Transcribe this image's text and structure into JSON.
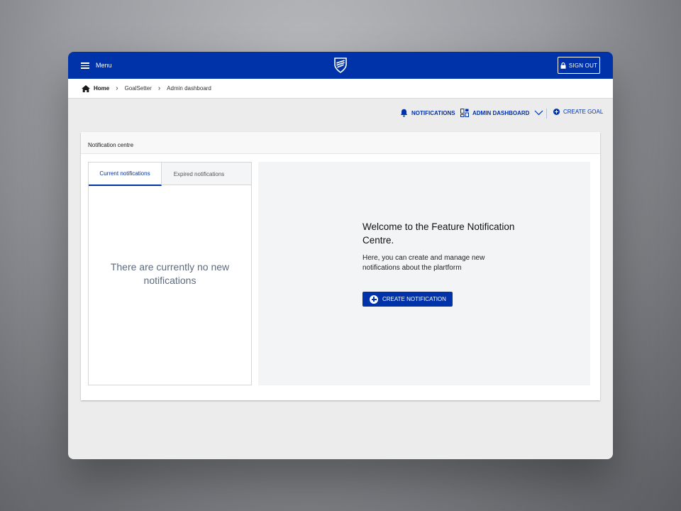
{
  "topbar": {
    "menu_label": "Menu",
    "signout_label": "SIGN OUT"
  },
  "breadcrumb": {
    "home": "Home",
    "items": [
      "GoalSetter",
      "Admin dashboard"
    ]
  },
  "actions": {
    "notifications": "NOTIFICATIONS",
    "admin_dashboard": "ADMIN DASHBOARD",
    "create_goal": "CREATE GOAL"
  },
  "panel": {
    "title": "Notification centre",
    "tabs": [
      {
        "label": "Current notifications",
        "active": true
      },
      {
        "label": "Expired notifications",
        "active": false
      }
    ],
    "empty_message": "There are currently no new notifications",
    "welcome_title": "Welcome to the Feature Notification Centre.",
    "welcome_body": "Here, you can create and manage new notifications about the plartform",
    "create_button": "CREATE NOTIFICATION"
  },
  "colors": {
    "brand_blue": "#0033aa",
    "empty_text": "#5d6b7f"
  }
}
